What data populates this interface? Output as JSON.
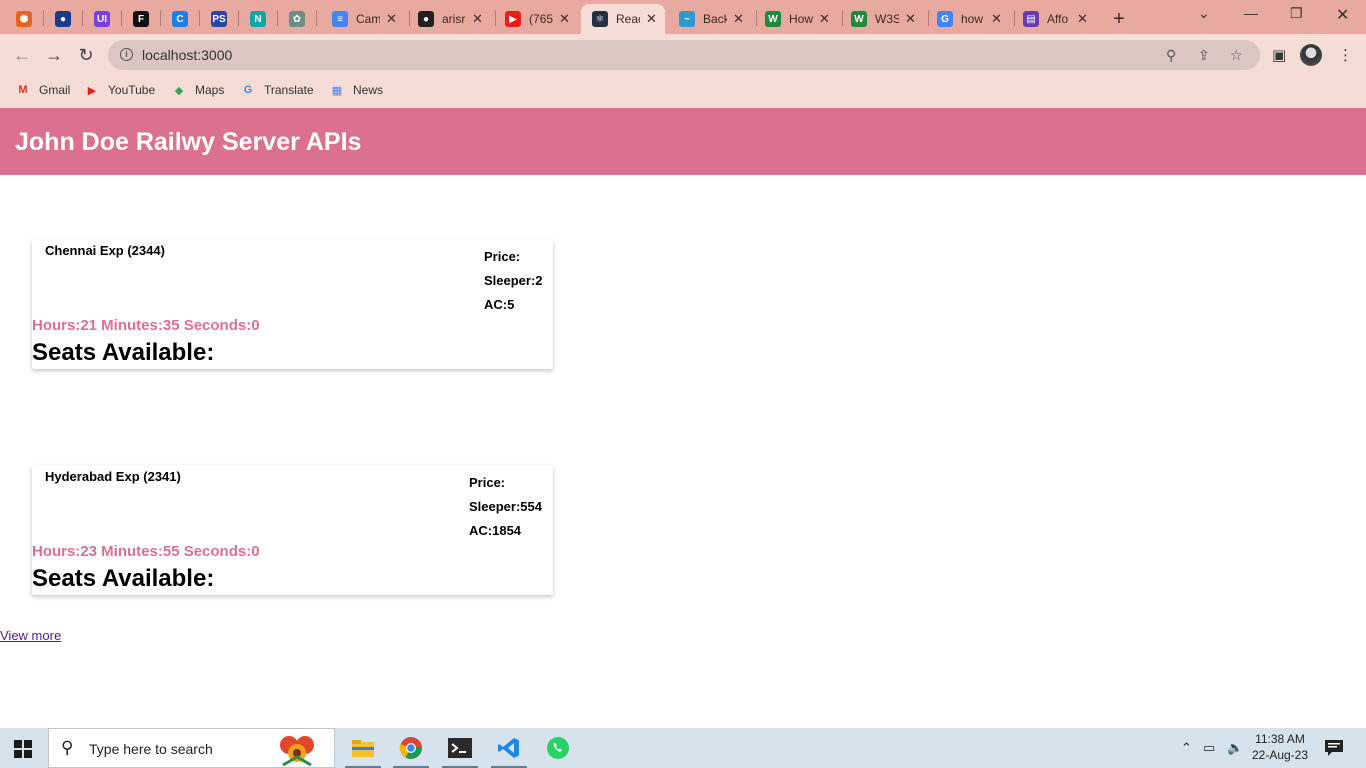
{
  "browser": {
    "tabs": [
      {
        "title": "",
        "fav_color": "#e8641d",
        "fav_glyph": "⬢"
      },
      {
        "title": "",
        "fav_color": "#1a3c8f",
        "fav_glyph": "●"
      },
      {
        "title": "",
        "fav_color": "#7a3fe0",
        "fav_glyph": "UI"
      },
      {
        "title": "",
        "fav_color": "#111111",
        "fav_glyph": "F"
      },
      {
        "title": "",
        "fav_color": "#1c7ee8",
        "fav_glyph": "C"
      },
      {
        "title": "",
        "fav_color": "#2a47a6",
        "fav_glyph": "PS"
      },
      {
        "title": "",
        "fav_color": "#12a5a5",
        "fav_glyph": "N"
      },
      {
        "title": "",
        "fav_color": "#6e8d86",
        "fav_glyph": "✿"
      },
      {
        "title": "Cam",
        "fav_color": "#4285f4",
        "fav_glyph": "≡"
      },
      {
        "title": "arisr",
        "fav_color": "#222222",
        "fav_glyph": "●"
      },
      {
        "title": "(765",
        "fav_color": "#e62117",
        "fav_glyph": "▶"
      },
      {
        "title": "Reac",
        "fav_color": "#22313f",
        "fav_glyph": "⚛"
      },
      {
        "title": "Back",
        "fav_color": "#2e9ad0",
        "fav_glyph": "~"
      },
      {
        "title": "How",
        "fav_color": "#1f8a3a",
        "fav_glyph": "W"
      },
      {
        "title": "W3S",
        "fav_color": "#1f8a3a",
        "fav_glyph": "W"
      },
      {
        "title": "how",
        "fav_color": "#4285f4",
        "fav_glyph": "G"
      },
      {
        "title": "Affo",
        "fav_color": "#6a3ab2",
        "fav_glyph": "▤"
      }
    ],
    "new_tab": "+",
    "url": "localhost:3000",
    "bookmarks": [
      {
        "label": "Gmail",
        "glyph": "M",
        "color": "#d93025"
      },
      {
        "label": "YouTube",
        "glyph": "▶",
        "color": "#e62117"
      },
      {
        "label": "Maps",
        "glyph": "◆",
        "color": "#34a853"
      },
      {
        "label": "Translate",
        "glyph": "G",
        "color": "#4285f4"
      },
      {
        "label": "News",
        "glyph": "▦",
        "color": "#4285f4"
      }
    ]
  },
  "page": {
    "title": "John Doe Railwy Server APIs",
    "trains": [
      {
        "name": "Chennai Exp (2344)",
        "price_label": "Price:",
        "sleeper": "Sleeper:2",
        "ac": "AC:5",
        "time_left": "Hours:21 Minutes:35 Seconds:0",
        "seats": "Seats Available:"
      },
      {
        "name": "Hyderabad Exp (2341)",
        "price_label": "Price:",
        "sleeper": "Sleeper:554",
        "ac": "AC:1854",
        "time_left": "Hours:23 Minutes:55 Seconds:0",
        "seats": "Seats Available:"
      }
    ],
    "view_more": "View more"
  },
  "taskbar": {
    "search_placeholder": "Type here to search",
    "time": "11:38 AM",
    "date": "22-Aug-23"
  },
  "colors": {
    "accent": "#db7091",
    "tabbar": "#e8aaa0",
    "toolbar": "#f6dcd6"
  }
}
